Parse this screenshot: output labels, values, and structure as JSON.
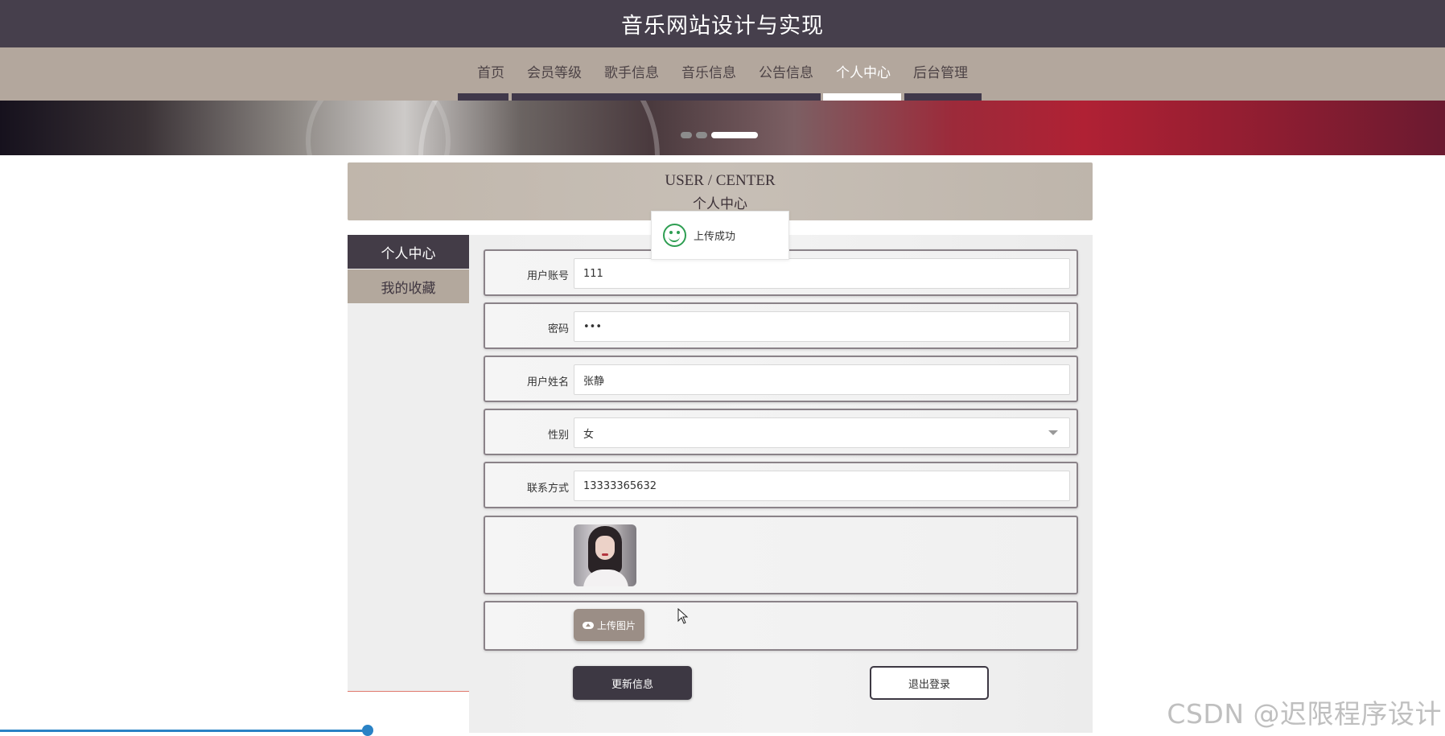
{
  "header": {
    "title": "音乐网站设计与实现"
  },
  "nav": {
    "items": [
      {
        "label": "首页",
        "active": false
      },
      {
        "label": "会员等级",
        "active": false
      },
      {
        "label": "歌手信息",
        "active": false
      },
      {
        "label": "音乐信息",
        "active": false
      },
      {
        "label": "公告信息",
        "active": false
      },
      {
        "label": "个人中心",
        "active": true
      },
      {
        "label": "后台管理",
        "active": false
      }
    ]
  },
  "banner": {
    "slide_count": 3,
    "active_slide_index": 2
  },
  "section": {
    "title_en": "USER / CENTER",
    "title_cn": "个人中心"
  },
  "toast": {
    "icon": "smile-icon",
    "message": "上传成功",
    "color": "#2e9e52"
  },
  "sidebar": {
    "items": [
      {
        "label": "个人中心",
        "active": true
      },
      {
        "label": "我的收藏",
        "active": false
      }
    ]
  },
  "form": {
    "account": {
      "label": "用户账号",
      "value": "111"
    },
    "password": {
      "label": "密码",
      "value": "•••"
    },
    "name": {
      "label": "用户姓名",
      "value": "张静"
    },
    "gender": {
      "label": "性别",
      "value": "女"
    },
    "phone": {
      "label": "联系方式",
      "value": "13333365632"
    },
    "upload_button": "上传图片",
    "update_button": "更新信息",
    "logout_button": "退出登录"
  },
  "watermark": "CSDN @迟限程序设计",
  "colors": {
    "header_bg": "#463f4c",
    "nav_bg": "#b3a79d",
    "accent_dark": "#3d3843",
    "toast_green": "#2e9e52",
    "progress_blue": "#2a82c5"
  }
}
